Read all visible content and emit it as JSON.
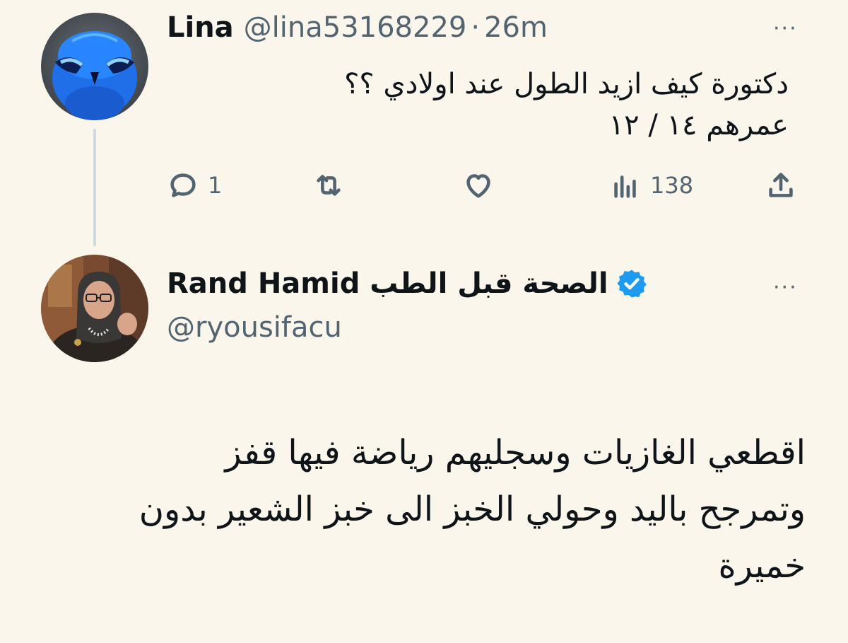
{
  "tweet1": {
    "name": "Lina",
    "handle": "@lina53168229",
    "separator": "·",
    "time": "26m",
    "more": "···",
    "text": "دكتورة كيف ازيد الطول عند اولادي ؟؟\nعمرهم ١٤ / ١٢",
    "actions": {
      "reply_count": "1",
      "views_count": "138"
    }
  },
  "tweet2": {
    "name": "Rand Hamid الصحة قبل الطب",
    "handle": "@ryousifacu",
    "more": "···",
    "text": "اقطعي الغازيات وسجليهم رياضة فيها قفز\nوتمرجح باليد وحولي الخبز الى خبز الشعير بدون\nخميرة"
  },
  "colors": {
    "background": "#fbf6ec",
    "secondary_text": "#536471",
    "verified": "#1d9bf0",
    "thread_line": "#cfd9de"
  },
  "icons": [
    "reply-icon",
    "retweet-icon",
    "like-icon",
    "views-icon",
    "share-icon",
    "verified-badge-icon",
    "more-icon"
  ]
}
